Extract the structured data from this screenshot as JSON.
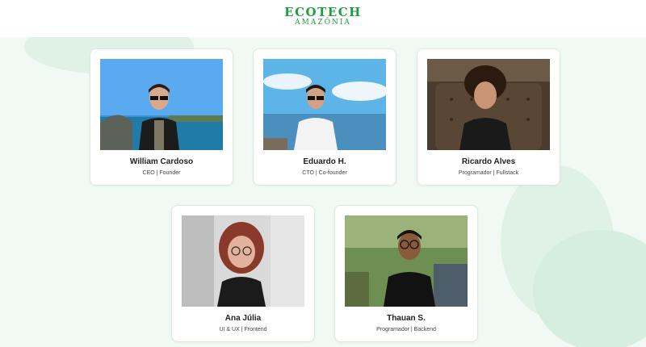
{
  "brand": {
    "line1": "ECOTECH",
    "line2": "AMAZÔNIA",
    "color": "#1f9d3f"
  },
  "team": [
    {
      "name": "William Cardoso",
      "role": "CEO | Founder",
      "photo": "portrait-beach-sunglasses"
    },
    {
      "name": "Eduardo H.",
      "role": "CTO | Co-founder",
      "photo": "portrait-sea-sunglasses"
    },
    {
      "name": "Ricardo Alves",
      "role": "Programador | Fullstack",
      "photo": "portrait-leather-sofa"
    },
    {
      "name": "Ana Júlia",
      "role": "UI & UX | Frontend",
      "photo": "portrait-glasses-red-hair"
    },
    {
      "name": "Thauan S.",
      "role": "Programador | Backend",
      "photo": "portrait-outdoor-glasses"
    }
  ],
  "colors": {
    "background": "#f0f9f3",
    "blob": "#dff2e5",
    "card": "#ffffff"
  }
}
